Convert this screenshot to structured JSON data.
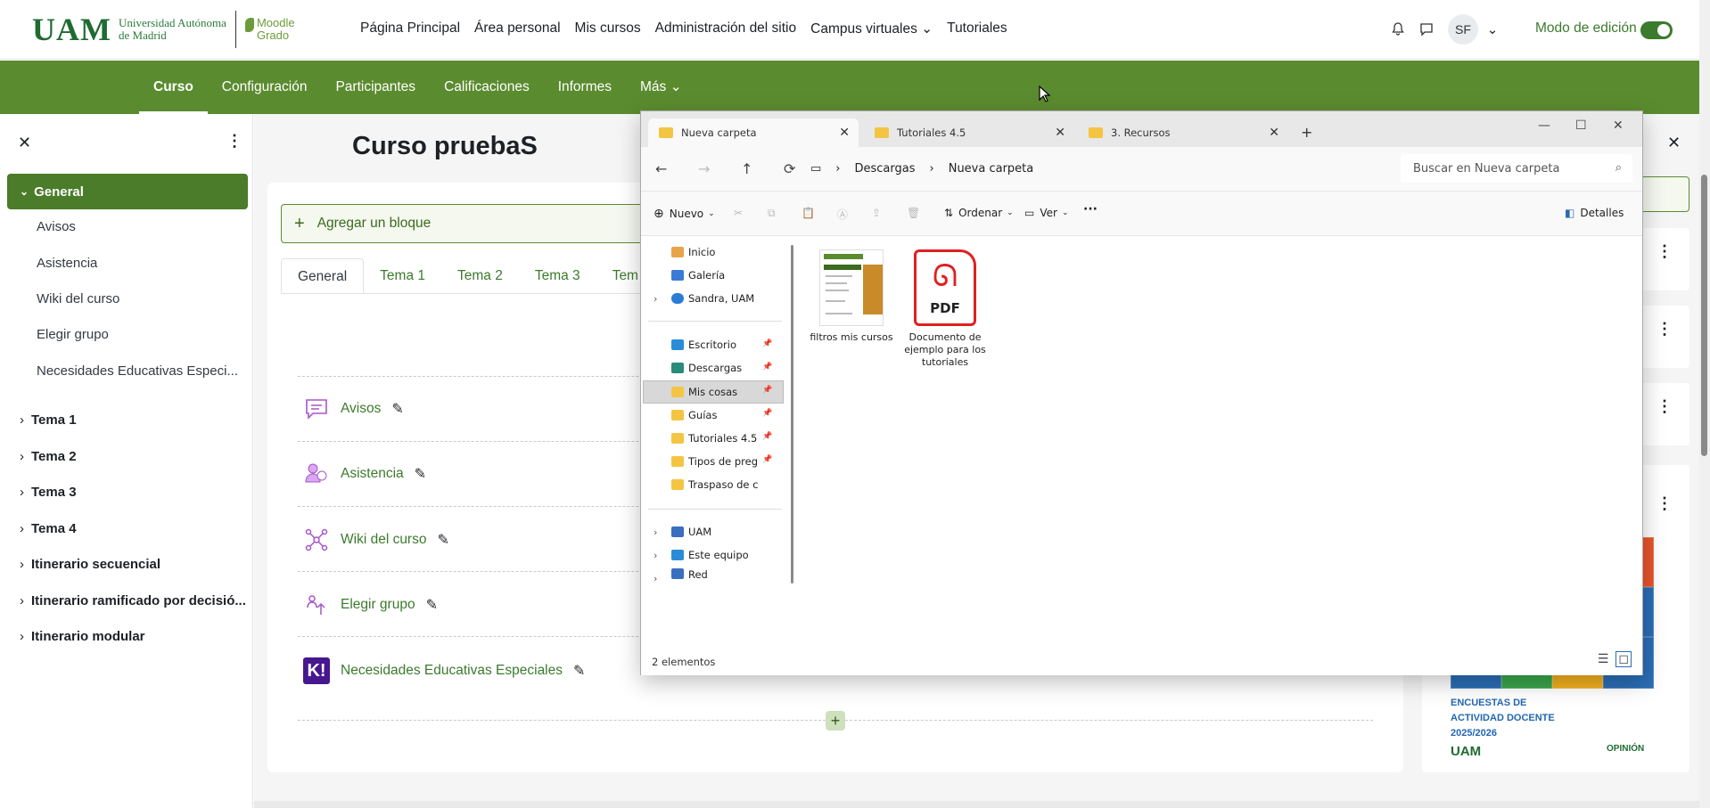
{
  "logo": {
    "uam": "UAM",
    "uam_name_1": "Universidad Autónoma",
    "uam_name_2": "de Madrid",
    "moodle_1": "Moodle",
    "moodle_2": "Grado"
  },
  "primary_nav": [
    "Página Principal",
    "Área personal",
    "Mis cursos",
    "Administración del sitio",
    "Campus virtuales ⌄",
    "Tutoriales"
  ],
  "user": {
    "initials": "SF",
    "edit_mode": "Modo de edición"
  },
  "secondary_nav": [
    "Curso",
    "Configuración",
    "Participantes",
    "Calificaciones",
    "Informes",
    "Más ⌄"
  ],
  "drawer": {
    "active": "General",
    "sub_items": [
      "Avisos",
      "Asistencia",
      "Wiki del curso",
      "Elegir grupo",
      "Necesidades Educativas Especi..."
    ],
    "sections": [
      "Tema 1",
      "Tema 2",
      "Tema 3",
      "Tema 4",
      "Itinerario secuencial",
      "Itinerario ramificado por decisió...",
      "Itinerario modular"
    ]
  },
  "course": {
    "title": "Curso pruebaS",
    "add_block": "Agregar un bloque",
    "tabs": [
      "General",
      "Tema 1",
      "Tema 2",
      "Tema 3",
      "Tem"
    ],
    "activities": [
      "Avisos",
      "Asistencia",
      "Wiki del curso",
      "Elegir grupo",
      "Necesidades Educativas Especiales"
    ]
  },
  "poster": {
    "line1": "ENCUESTAS DE",
    "line2": "ACTIVIDAD DOCENTE",
    "line3": "2025/2026",
    "uam": "UAM",
    "opinion": "OPINIÓN"
  },
  "explorer": {
    "tabs": [
      "Nueva carpeta",
      "Tutoriales 4.5",
      "3. Recursos"
    ],
    "breadcrumb": [
      "Descargas",
      "Nueva carpeta"
    ],
    "search_placeholder": "Buscar en Nueva carpeta",
    "commands": {
      "new": "Nuevo",
      "sort": "Ordenar",
      "view": "Ver",
      "details": "Detalles"
    },
    "nav": {
      "top": [
        "Inicio",
        "Galería",
        "Sandra, UAM"
      ],
      "pinned": [
        "Escritorio",
        "Descargas",
        "Mis cosas",
        "Guías",
        "Tutoriales 4.5",
        "Tipos de pregunt",
        "Traspaso de conteni"
      ],
      "bottom": [
        "UAM",
        "Este equipo",
        "Red"
      ]
    },
    "files": [
      {
        "name": "filtros mis cursos",
        "icon": "image-thumbnail"
      },
      {
        "name": "Documento de ejemplo para los tutoriales",
        "icon": "pdf-icon"
      }
    ],
    "pdf_label": "PDF",
    "status": "2 elementos"
  },
  "colors": {
    "primary": "#5b8b2f",
    "accent": "#3c7a2d",
    "pdf": "#e02020",
    "folder": "#f4c542"
  }
}
